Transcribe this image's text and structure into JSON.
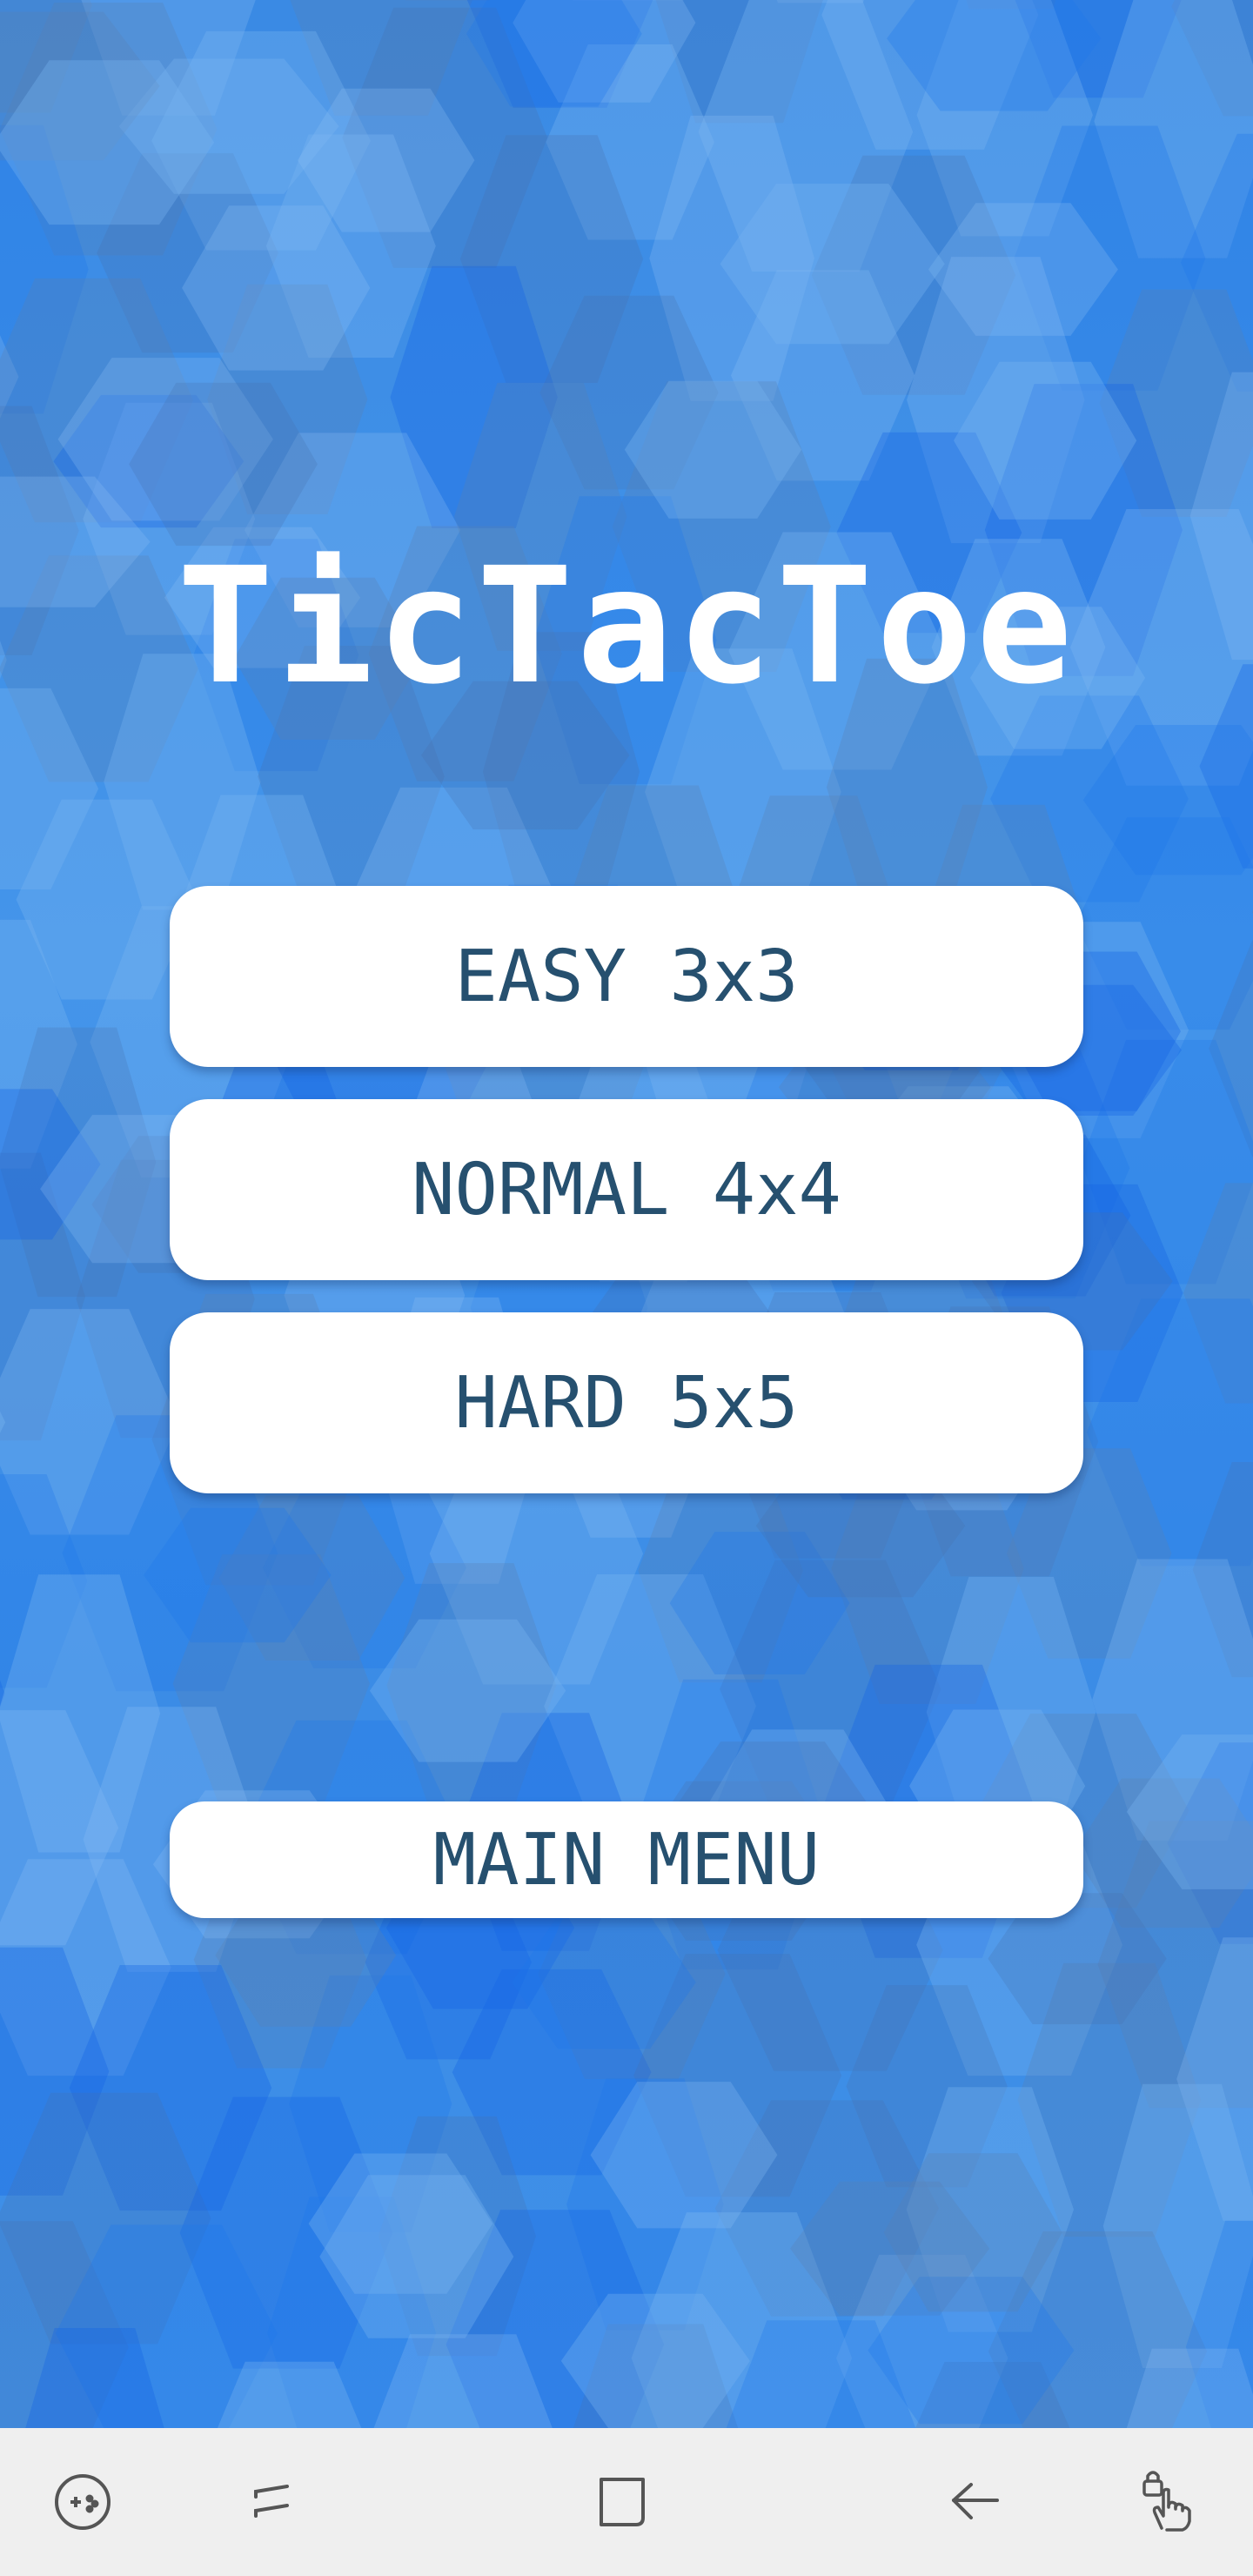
{
  "app": {
    "title": "TicTacToe"
  },
  "menu": {
    "easy_label": "EASY 3x3",
    "normal_label": "NORMAL 4x4",
    "hard_label": "HARD 5x5",
    "main_menu_label": "MAIN MENU"
  },
  "navbar": {
    "icons": [
      "game-tools-icon",
      "recent-apps-icon",
      "home-icon",
      "back-icon",
      "touch-lock-icon"
    ]
  },
  "colors": {
    "background": "#3f8fe6",
    "button_bg": "#ffffff",
    "button_text": "#26506f",
    "title_text": "#ffffff",
    "navbar_bg": "#efefef",
    "navbar_icon": "#555555"
  }
}
